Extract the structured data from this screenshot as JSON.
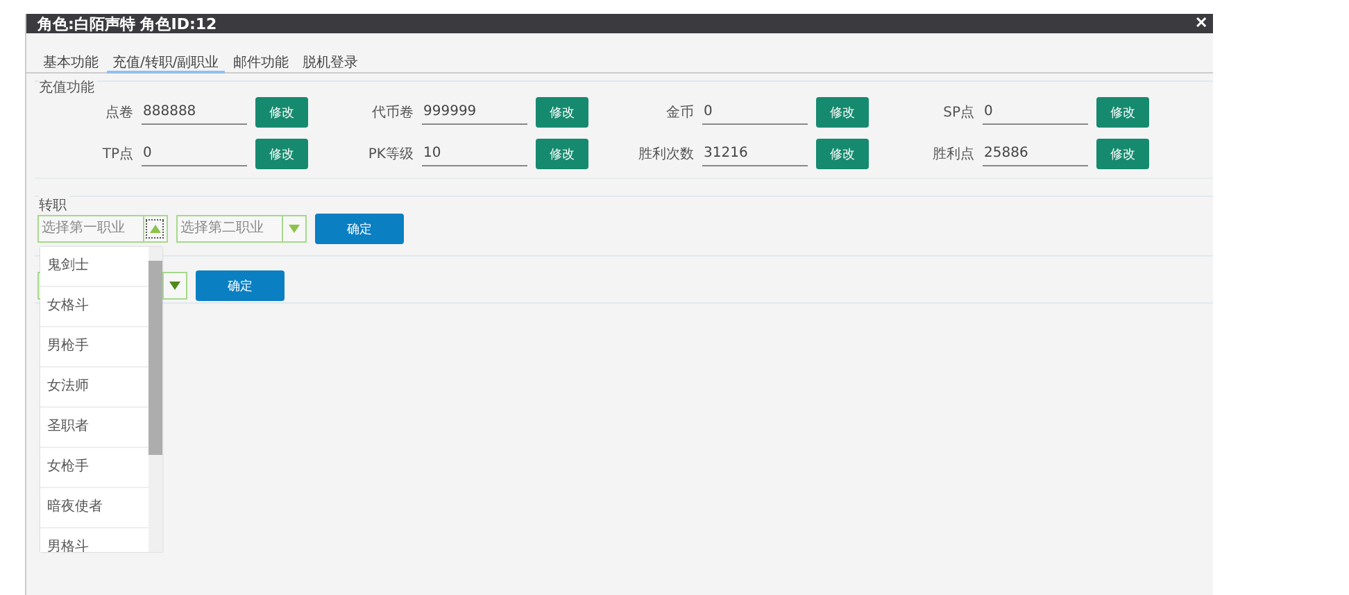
{
  "window": {
    "title": "角色:白陌声特 角色ID:12",
    "close": "✕"
  },
  "tabs": [
    {
      "label": "基本功能",
      "selected": false
    },
    {
      "label": "充值/转职/副职业",
      "selected": true
    },
    {
      "label": "邮件功能",
      "selected": false
    },
    {
      "label": "脱机登录",
      "selected": false
    }
  ],
  "recharge": {
    "title": "充值功能",
    "fields": [
      {
        "label": "点卷",
        "value": "888888",
        "button": "修改"
      },
      {
        "label": "代币卷",
        "value": "999999",
        "button": "修改"
      },
      {
        "label": "金币",
        "value": "0",
        "button": "修改"
      },
      {
        "label": "SP点",
        "value": "0",
        "button": "修改"
      },
      {
        "label": "TP点",
        "value": "0",
        "button": "修改"
      },
      {
        "label": "PK等级",
        "value": "10",
        "button": "修改"
      },
      {
        "label": "胜利次数",
        "value": "31216",
        "button": "修改"
      },
      {
        "label": "胜利点",
        "value": "25886",
        "button": "修改"
      }
    ]
  },
  "job_change": {
    "title": "转职",
    "first_select": {
      "placeholder": "选择第一职业",
      "expanded": true
    },
    "second_select": {
      "placeholder": "选择第二职业",
      "expanded": false
    },
    "button": "确定"
  },
  "sub_job": {
    "button": "确定"
  },
  "dropdown": {
    "items": [
      "鬼剑士",
      "女格斗",
      "男枪手",
      "女法师",
      "圣职者",
      "女枪手",
      "暗夜使者",
      "男格斗"
    ]
  }
}
